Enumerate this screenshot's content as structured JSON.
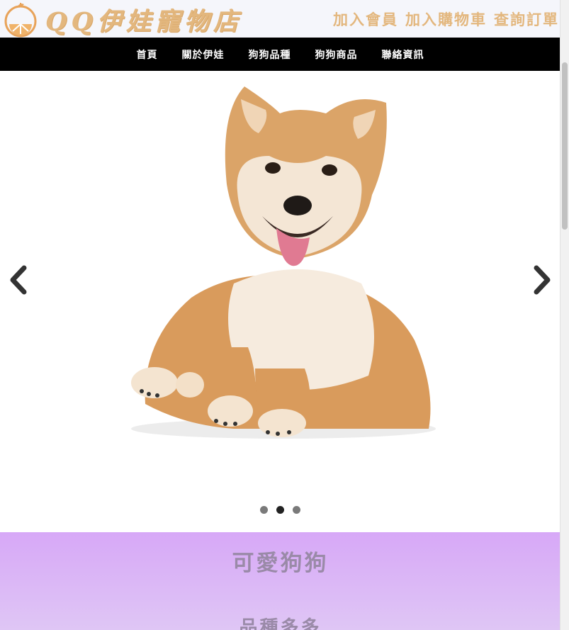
{
  "header": {
    "brand": "QQ伊娃寵物店",
    "links": [
      "加入會員",
      "加入購物車",
      "查詢訂單"
    ]
  },
  "nav": {
    "items": [
      "首頁",
      "關於伊娃",
      "狗狗品種",
      "狗狗商品",
      "聯絡資訊"
    ]
  },
  "carousel": {
    "slides": 3,
    "active_slide": 2,
    "image_subject": "shiba-inu-dog"
  },
  "section": {
    "title": "可愛狗狗",
    "subtitle": "品種多多"
  },
  "colors": {
    "brand": "#e3b77e",
    "nav_bg": "#000000",
    "section_bg": "#d7a8f7"
  }
}
